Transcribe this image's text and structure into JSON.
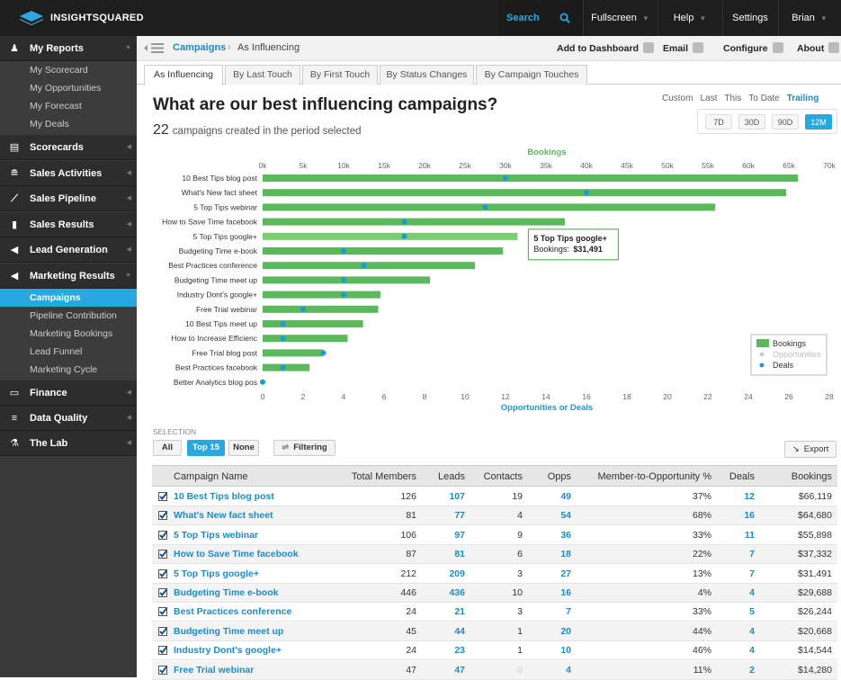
{
  "topbar": {
    "logo_text": "INSIGHTSQUARED",
    "search_label": "Search",
    "fullscreen_label": "Fullscreen",
    "help_label": "Help",
    "settings_label": "Settings",
    "user_label": "Brian"
  },
  "sidebar": {
    "sections": [
      {
        "label": "My Reports",
        "icon": "person-icon"
      },
      {
        "label": "Scorecards",
        "icon": "document-icon"
      },
      {
        "label": "Sales Activities",
        "icon": "activity-icon"
      },
      {
        "label": "Sales Pipeline",
        "icon": "line-chart-icon"
      },
      {
        "label": "Sales Results",
        "icon": "bar-chart-icon"
      },
      {
        "label": "Lead Generation",
        "icon": "megaphone-icon"
      },
      {
        "label": "Marketing Results",
        "icon": "megaphone-icon"
      },
      {
        "label": "Finance",
        "icon": "money-icon"
      },
      {
        "label": "Data Quality",
        "icon": "filter-icon"
      },
      {
        "label": "The Lab",
        "icon": "flask-icon"
      }
    ],
    "my_reports_items": [
      "My Scorecard",
      "My Opportunities",
      "My Forecast",
      "My Deals"
    ],
    "marketing_items": [
      "Campaigns",
      "Pipeline Contribution",
      "Marketing Bookings",
      "Lead Funnel",
      "Marketing Cycle"
    ]
  },
  "header": {
    "crumb_link": "Campaigns",
    "crumb_sep": "›",
    "crumb_current": "As Influencing",
    "add_dashboard": "Add to Dashboard",
    "email": "Email",
    "configure": "Configure",
    "about": "About"
  },
  "tabs": [
    "As Influencing",
    "By Last Touch",
    "By First Touch",
    "By Status Changes",
    "By Campaign Touches"
  ],
  "headline": "What are our best influencing campaigns?",
  "subline": {
    "count": "22",
    "text": "campaigns created in the period selected"
  },
  "periods": {
    "labels": [
      "Custom",
      "Last",
      "This",
      "To Date",
      "Trailing"
    ],
    "buttons": [
      "7D",
      "30D",
      "90D",
      "12M"
    ]
  },
  "chart_data": {
    "type": "bar",
    "top_axis_label": "Bookings",
    "bottom_axis_label": "Opportunities or Deals",
    "top_ticks": [
      "0k",
      "5k",
      "10k",
      "15k",
      "20k",
      "25k",
      "30k",
      "35k",
      "40k",
      "45k",
      "50k",
      "55k",
      "60k",
      "65k",
      "70k"
    ],
    "bottom_ticks": [
      "0",
      "2",
      "4",
      "6",
      "8",
      "10",
      "12",
      "14",
      "16",
      "18",
      "20",
      "22",
      "24",
      "26",
      "28"
    ],
    "top_range": [
      0,
      70000
    ],
    "bottom_range": [
      0,
      28
    ],
    "categories": [
      "10 Best Tips blog post",
      "What's New fact sheet",
      "5 Top Tips webinar",
      "How to Save Time facebook",
      "5 Top Tips google+",
      "Budgeting Time e-book",
      "Best Practices conference",
      "Budgeting Time meet up",
      "Industry Dont's google+",
      "Free Trial webinar",
      "10 Best Tips meet up",
      "How to Increase Efficienc",
      "Free Trial blog post",
      "Best Practices facebook",
      "Better Analytics blog pos"
    ],
    "series": [
      {
        "name": "Bookings",
        "values": [
          66119,
          64680,
          55898,
          37332,
          31491,
          29688,
          26244,
          20668,
          14544,
          14280,
          12400,
          10500,
          7500,
          5800,
          0
        ]
      },
      {
        "name": "Deals",
        "values": [
          12,
          16,
          11,
          7,
          7,
          4,
          5,
          4,
          4,
          2,
          1,
          1,
          3,
          1,
          0
        ]
      }
    ],
    "legend": [
      "Bookings",
      "Opportunities",
      "Deals"
    ],
    "tooltip": {
      "title": "5 Top Tips google+",
      "label": "Bookings:",
      "value": "$31,491"
    },
    "colors": {
      "bar": "#5cb85c",
      "bar_hover": "#7ccd72",
      "deal": "#1a9ad6"
    }
  },
  "selection": {
    "label": "SELECTION",
    "all": "All",
    "top15": "Top 15",
    "none": "None",
    "filtering": "Filtering",
    "export": "Export"
  },
  "table": {
    "headers": [
      "Campaign Name",
      "Total Members",
      "Leads",
      "Contacts",
      "Opps",
      "Member-to-Opportunity %",
      "Deals",
      "Bookings"
    ],
    "rows": [
      [
        "10 Best Tips blog post",
        "126",
        "107",
        "19",
        "49",
        "37%",
        "12",
        "$66,119"
      ],
      [
        "What's New fact sheet",
        "81",
        "77",
        "4",
        "54",
        "68%",
        "16",
        "$64,680"
      ],
      [
        "5 Top Tips webinar",
        "106",
        "97",
        "9",
        "36",
        "33%",
        "11",
        "$55,898"
      ],
      [
        "How to Save Time facebook",
        "87",
        "81",
        "6",
        "18",
        "22%",
        "7",
        "$37,332"
      ],
      [
        "5 Top Tips google+",
        "212",
        "209",
        "3",
        "27",
        "13%",
        "7",
        "$31,491"
      ],
      [
        "Budgeting Time e-book",
        "446",
        "436",
        "10",
        "16",
        "4%",
        "4",
        "$29,688"
      ],
      [
        "Best Practices conference",
        "24",
        "21",
        "3",
        "7",
        "33%",
        "5",
        "$26,244"
      ],
      [
        "Budgeting Time meet up",
        "45",
        "44",
        "1",
        "20",
        "44%",
        "4",
        "$20,668"
      ],
      [
        "Industry Dont's google+",
        "24",
        "23",
        "1",
        "10",
        "46%",
        "4",
        "$14,544"
      ],
      [
        "Free Trial webinar",
        "47",
        "47",
        "0",
        "4",
        "11%",
        "2",
        "$14,280"
      ]
    ]
  }
}
